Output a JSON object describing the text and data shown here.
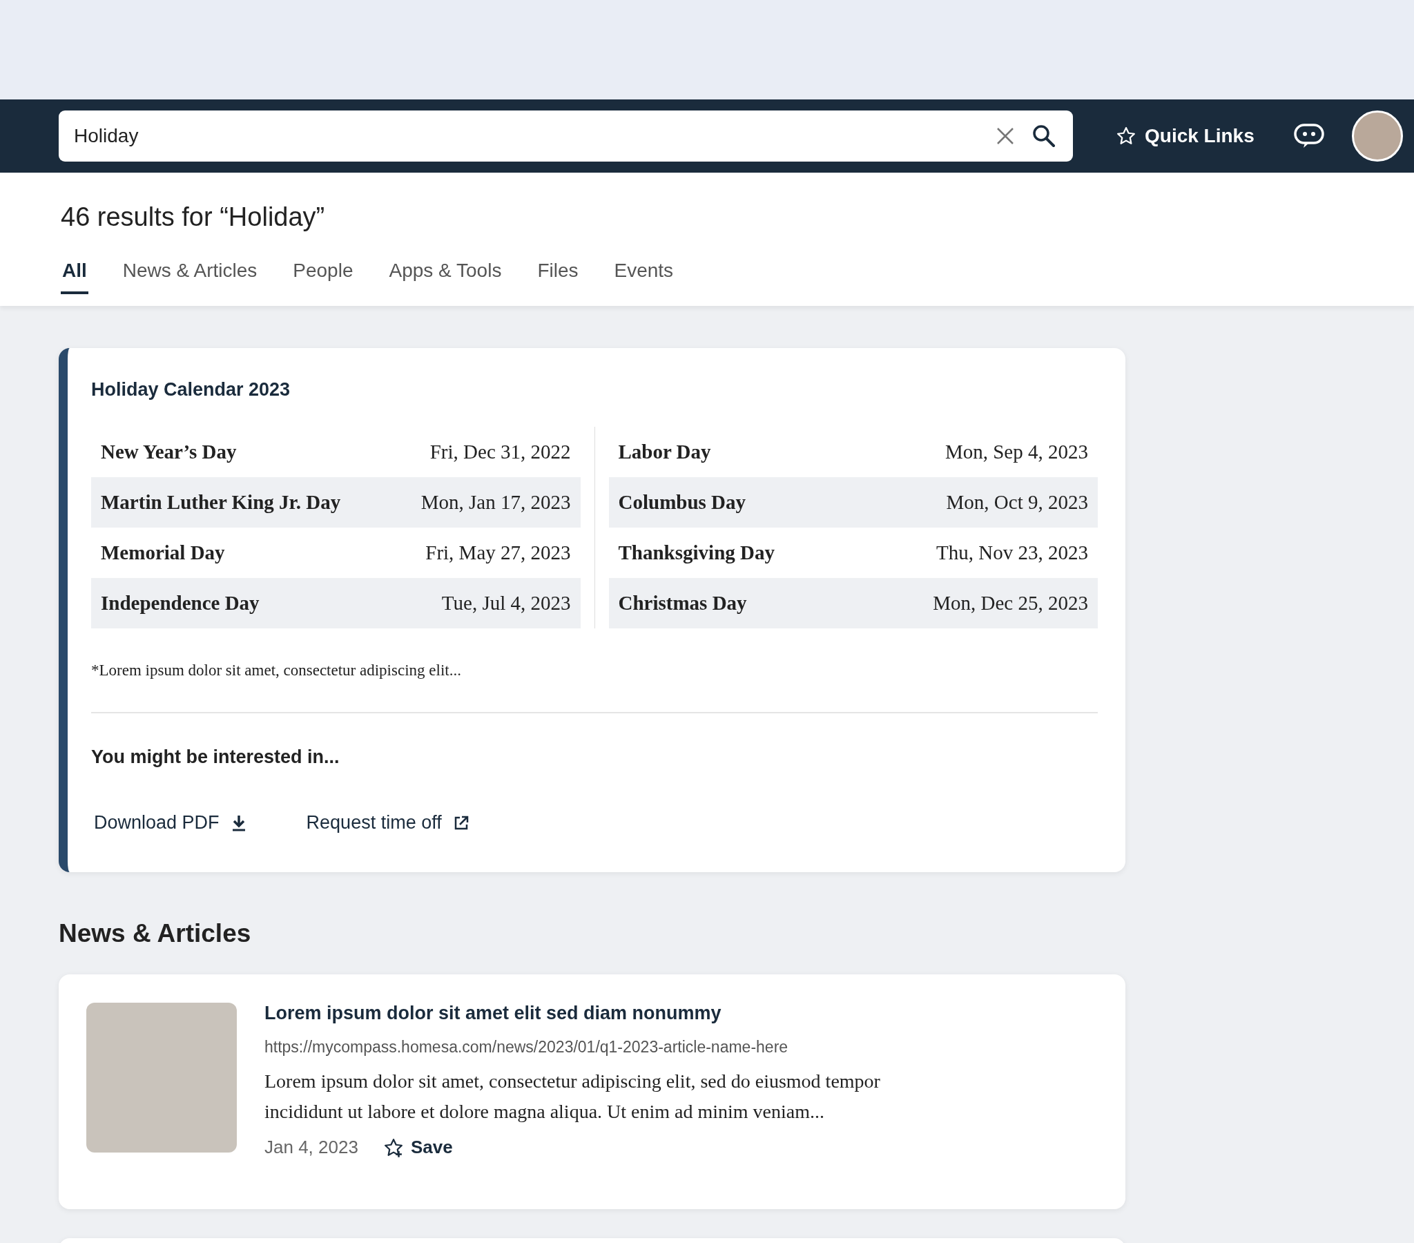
{
  "header": {
    "search": {
      "value": "Holiday"
    },
    "quick_links": "Quick Links"
  },
  "results_title": "46 results for “Holiday”",
  "tabs": [
    {
      "label": "All",
      "selected": true
    },
    {
      "label": "News & Articles",
      "selected": false
    },
    {
      "label": "People",
      "selected": false
    },
    {
      "label": "Apps & Tools",
      "selected": false
    },
    {
      "label": "Files",
      "selected": false
    },
    {
      "label": "Events",
      "selected": false
    }
  ],
  "holiday_card": {
    "title": "Holiday Calendar 2023",
    "columns": [
      [
        {
          "name": "New Year’s Day",
          "date": "Fri, Dec 31, 2022"
        },
        {
          "name": "Martin Luther King Jr. Day",
          "date": "Mon, Jan 17, 2023"
        },
        {
          "name": "Memorial Day",
          "date": "Fri, May 27, 2023"
        },
        {
          "name": "Independence Day",
          "date": "Tue, Jul 4, 2023"
        }
      ],
      [
        {
          "name": "Labor Day",
          "date": "Mon, Sep 4, 2023"
        },
        {
          "name": "Columbus Day",
          "date": "Mon, Oct 9, 2023"
        },
        {
          "name": "Thanksgiving Day",
          "date": "Thu, Nov 23, 2023"
        },
        {
          "name": "Christmas Day",
          "date": "Mon, Dec 25, 2023"
        }
      ]
    ],
    "footnote": "*Lorem ipsum dolor sit amet, consectetur adipiscing elit...",
    "interested_title": "You might be interested in...",
    "links": [
      {
        "label": "Download PDF",
        "kind": "download"
      },
      {
        "label": "Request time off",
        "kind": "external"
      }
    ]
  },
  "news": {
    "heading": "News & Articles",
    "articles": [
      {
        "title": "Lorem ipsum dolor sit amet elit sed diam nonummy",
        "url": "https://mycompass.homesa.com/news/2023/01/q1-2023-article-name-here",
        "description": "Lorem ipsum dolor sit amet, consectetur adipiscing elit, sed do eiusmod tempor incididunt ut labore et dolore magna aliqua. Ut enim ad minim veniam...",
        "date": "Jan 4, 2023",
        "save": "Save"
      }
    ]
  }
}
